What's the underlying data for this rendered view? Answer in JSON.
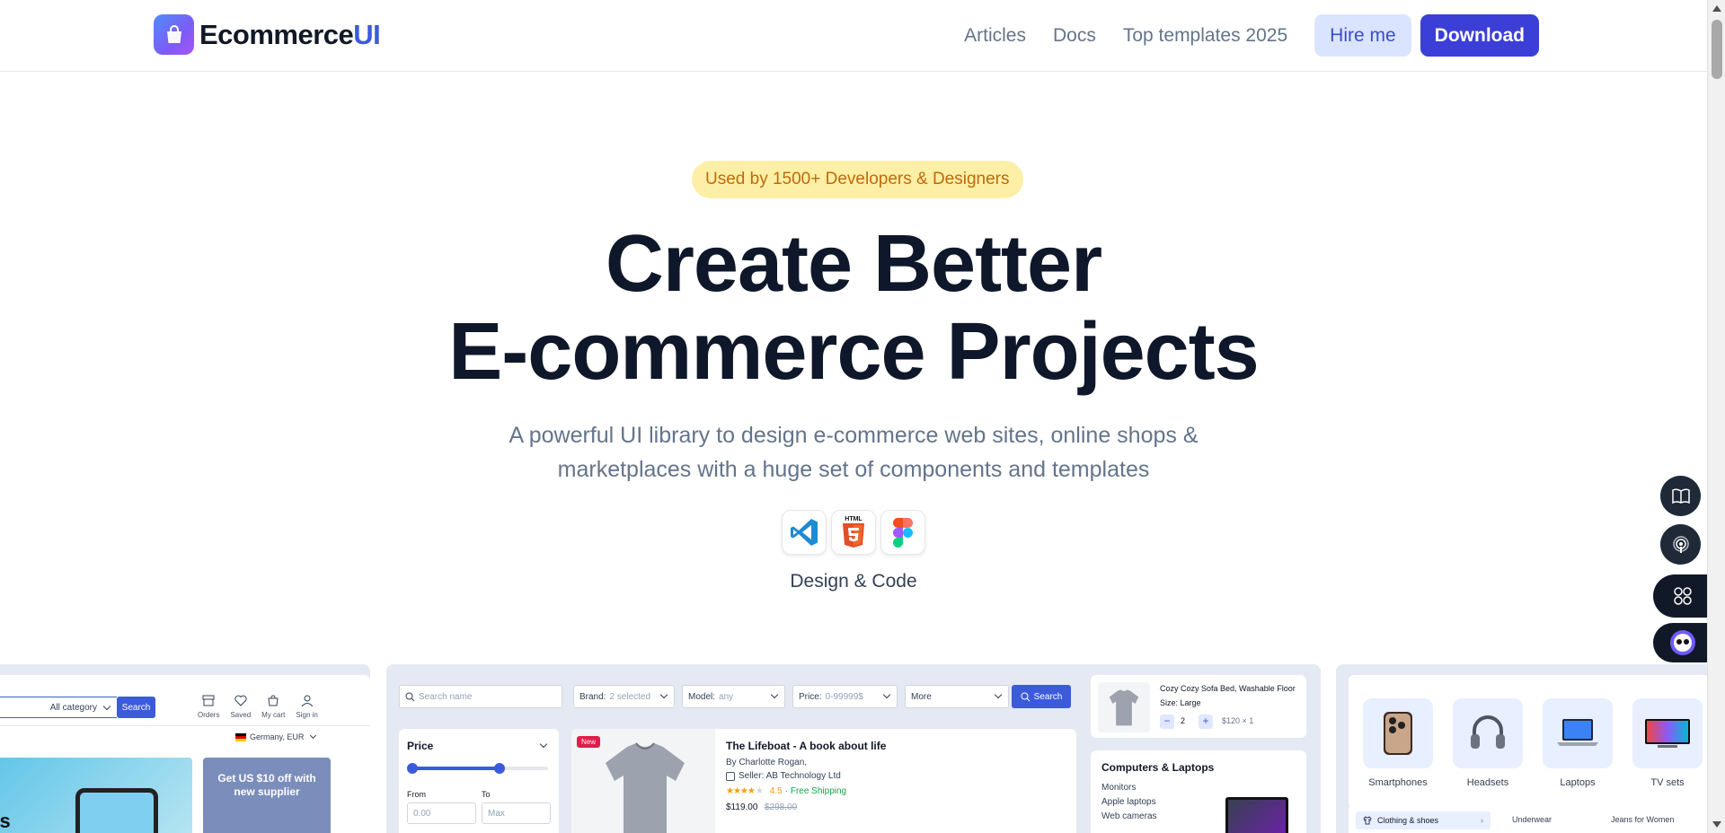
{
  "brand": {
    "name_main": "Ecommerce",
    "name_accent": "UI"
  },
  "nav": {
    "links": [
      "Articles",
      "Docs",
      "Top templates 2025"
    ],
    "hire_label": "Hire me",
    "download_label": "Download"
  },
  "hero": {
    "badge": "Used by 1500+ Developers & Designers",
    "title_line1": "Create Better",
    "title_line2": "E-commerce Projects",
    "subtitle_line1": "A powerful UI library to design e-commerce web sites, online shops &",
    "subtitle_line2": "marketplaces with a huge set of components and templates",
    "tools": [
      "vscode-icon",
      "html5-icon",
      "figma-icon"
    ],
    "tools_caption": "Design & Code"
  },
  "preview1": {
    "category": "All category",
    "search": "Search",
    "actions": [
      "Orders",
      "Saved",
      "My cart",
      "Sign in"
    ],
    "region": "Germany, EUR",
    "banner_partial": "ms",
    "promo": "Get US $10 off with new supplier"
  },
  "preview2": {
    "search_placeholder": "Search name",
    "brand_label": "Brand:",
    "brand_value": "2 selected",
    "model_label": "Model:",
    "model_value": "any",
    "price_label": "Price:",
    "price_value": "0-99999$",
    "more": "More",
    "search_btn": "Search",
    "filter_title": "Price",
    "from_label": "From",
    "to_label": "To",
    "from_placeholder": "0.00",
    "to_placeholder": "Max",
    "new_badge": "New",
    "product_title": "The Lifeboat - A book about life",
    "product_author": "By Charlotte Rogan,",
    "product_seller": "Seller: AB Technology Ltd",
    "rating": "4.5",
    "rating_value": 4.5,
    "shipping": "· Free Shipping",
    "price": "$119.00",
    "old_price": "$298.00",
    "cart_item_title": "Cozy Cozy Sofa Bed, Washable Floor",
    "cart_item_size": "Size: Large",
    "cart_qty": "2",
    "cart_price": "$120 × 1",
    "group_title": "Computers & Laptops",
    "group_items": [
      "Monitors",
      "Apple laptops",
      "Web cameras"
    ]
  },
  "preview3": {
    "categories": [
      "Smartphones",
      "Headsets",
      "Laptops",
      "TV sets"
    ],
    "menu_active": "Clothing & shoes",
    "menu_items": [
      "Underwear",
      "Jeans for Women"
    ]
  },
  "colors": {
    "accent": "#3b3fd8",
    "badge_bg": "#fdf0a6",
    "badge_text": "#c2680b",
    "title": "#0f172a"
  }
}
